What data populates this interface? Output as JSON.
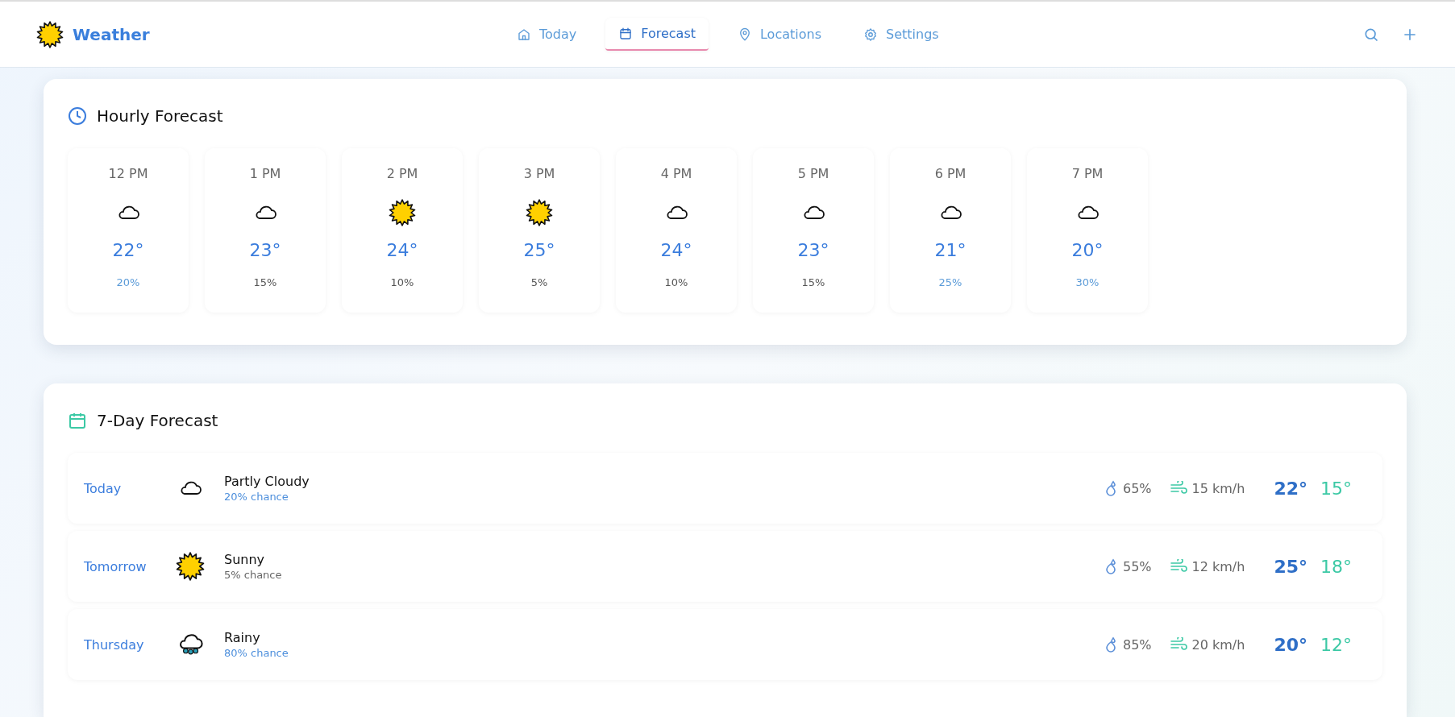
{
  "header": {
    "app_name": "Weather",
    "nav": [
      {
        "label": "Today",
        "kind": "home",
        "selected": false
      },
      {
        "label": "Forecast",
        "kind": "calendar",
        "selected": true
      },
      {
        "label": "Locations",
        "kind": "pin",
        "selected": false
      },
      {
        "label": "Settings",
        "kind": "gear",
        "selected": false
      }
    ]
  },
  "hourly": {
    "title": "Hourly Forecast",
    "hours": [
      {
        "time": "12 PM",
        "kind": "cloudy",
        "temp": "22°",
        "chance": "20%",
        "likely": true
      },
      {
        "time": "1 PM",
        "kind": "cloudy",
        "temp": "23°",
        "chance": "15%",
        "likely": false
      },
      {
        "time": "2 PM",
        "kind": "sunny",
        "temp": "24°",
        "chance": "10%",
        "likely": false
      },
      {
        "time": "3 PM",
        "kind": "sunny",
        "temp": "25°",
        "chance": "5%",
        "likely": false
      },
      {
        "time": "4 PM",
        "kind": "cloudy",
        "temp": "24°",
        "chance": "10%",
        "likely": false
      },
      {
        "time": "5 PM",
        "kind": "cloudy",
        "temp": "23°",
        "chance": "15%",
        "likely": false
      },
      {
        "time": "6 PM",
        "kind": "cloudy",
        "temp": "21°",
        "chance": "25%",
        "likely": true
      },
      {
        "time": "7 PM",
        "kind": "cloudy",
        "temp": "20°",
        "chance": "30%",
        "likely": true
      }
    ]
  },
  "daily": {
    "title": "7-Day Forecast",
    "days": [
      {
        "day": "Today",
        "kind": "cloudy",
        "condition": "Partly Cloudy",
        "chance": "20% chance",
        "likely": true,
        "humidity": "65%",
        "wind": "15 km/h",
        "high": "22°",
        "low": "15°"
      },
      {
        "day": "Tomorrow",
        "kind": "sunny",
        "condition": "Sunny",
        "chance": "5% chance",
        "likely": false,
        "humidity": "55%",
        "wind": "12 km/h",
        "high": "25°",
        "low": "18°"
      },
      {
        "day": "Thursday",
        "kind": "rainy",
        "condition": "Rainy",
        "chance": "80% chance",
        "likely": true,
        "humidity": "85%",
        "wind": "20 km/h",
        "high": "20°",
        "low": "12°"
      }
    ]
  }
}
